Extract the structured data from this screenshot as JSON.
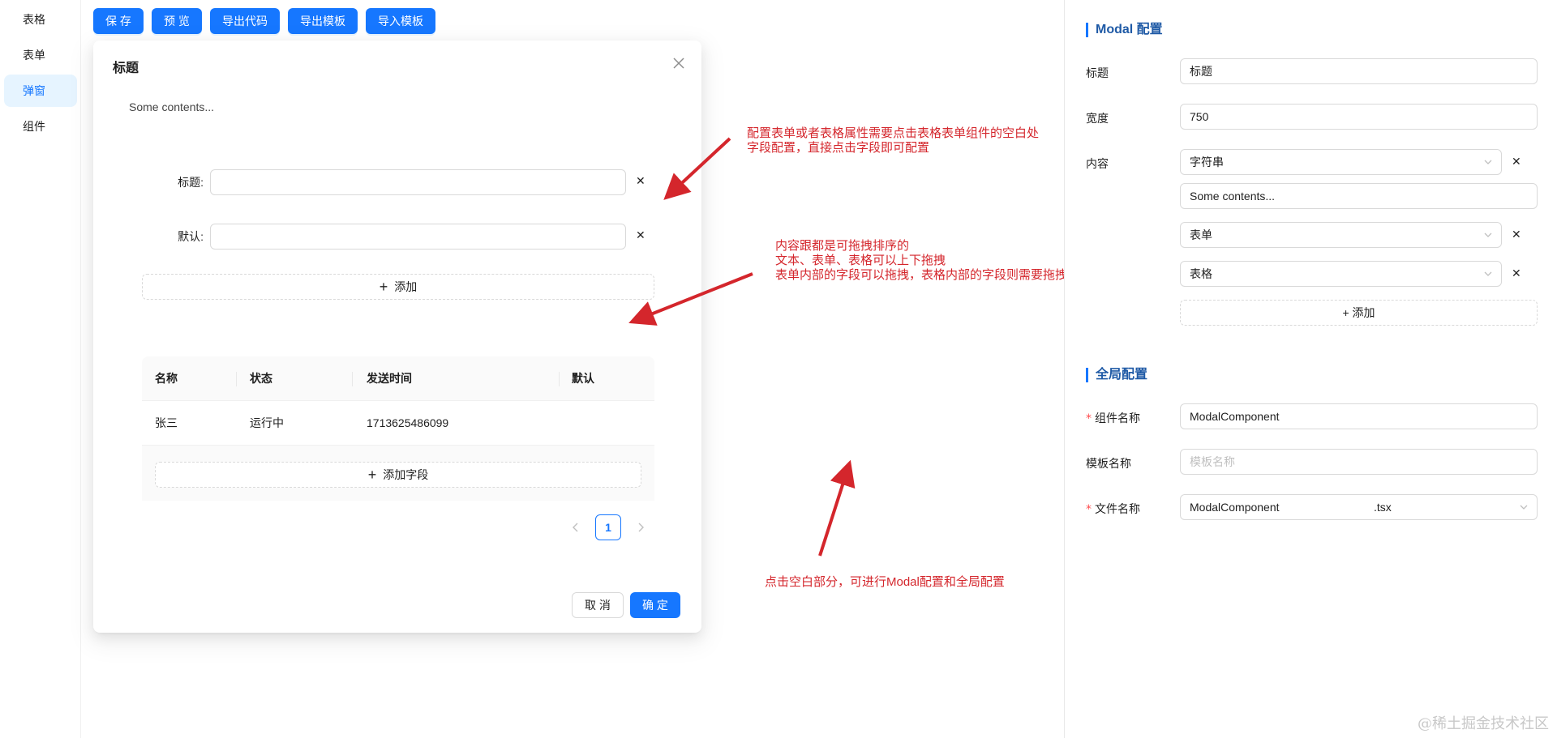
{
  "sidebar": {
    "items": [
      {
        "label": "表格",
        "active": false
      },
      {
        "label": "表单",
        "active": false
      },
      {
        "label": "弹窗",
        "active": true
      },
      {
        "label": "组件",
        "active": false
      }
    ]
  },
  "toolbar": {
    "save": "保 存",
    "preview": "预 览",
    "export_code": "导出代码",
    "export_template": "导出模板",
    "import_template": "导入模板"
  },
  "modal": {
    "title": "标题",
    "content_text": "Some contents...",
    "form": {
      "fields": [
        {
          "label": "标题:",
          "value": ""
        },
        {
          "label": "默认:",
          "value": ""
        }
      ],
      "add_label": "添加"
    },
    "table": {
      "columns": [
        "名称",
        "状态",
        "发送时间",
        "默认"
      ],
      "rows": [
        [
          "张三",
          "运行中",
          "1713625486099",
          ""
        ]
      ],
      "add_field_label": "添加字段"
    },
    "pagination": {
      "current": "1"
    },
    "cancel": "取 消",
    "ok": "确 定"
  },
  "annotations": {
    "note1": [
      "配置表单或者表格属性需要点击表格表单组件的空白处",
      "字段配置，直接点击字段即可配置"
    ],
    "note2": [
      "内容跟都是可拖拽排序的",
      "文本、表单、表格可以上下拖拽",
      "表单内部的字段可以拖拽，表格内部的字段则需要拖拽表头"
    ],
    "note3": "点击空白部分，可进行Modal配置和全局配置",
    "color": "#d4262c"
  },
  "right_panel": {
    "modal_config": {
      "title": "Modal 配置",
      "title_label": "标题",
      "title_value": "标题",
      "width_label": "宽度",
      "width_value": "750",
      "content_label": "内容",
      "content_items": [
        {
          "type": "字符串",
          "text": "Some contents..."
        },
        {
          "type": "表单"
        },
        {
          "type": "表格"
        }
      ],
      "add_label": "+ 添加"
    },
    "global_config": {
      "title": "全局配置",
      "component_name_label": "组件名称",
      "component_name_value": "ModalComponent",
      "template_name_label": "模板名称",
      "template_name_placeholder": "模板名称",
      "file_name_label": "文件名称",
      "file_name_value": "ModalComponent",
      "file_ext": ".tsx"
    }
  },
  "watermark": "@稀土掘金技术社区",
  "colors": {
    "primary": "#1677ff",
    "active_bg": "#e6f4ff",
    "section_title": "#1f5aa6"
  }
}
